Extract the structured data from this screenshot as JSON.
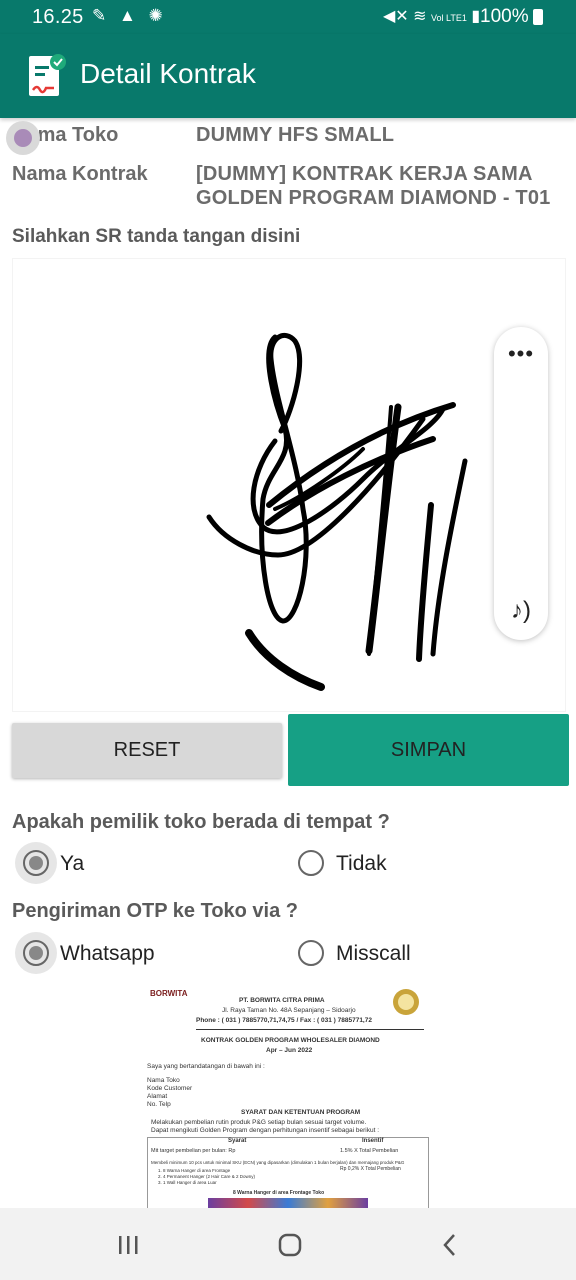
{
  "status_bar": {
    "time": "16.25",
    "left_icons": [
      "tools-icon",
      "warning-icon",
      "aperture-icon"
    ],
    "network": "Vol LTE1",
    "battery": "100%"
  },
  "app_bar": {
    "title": "Detail Kontrak",
    "icon": "contract-document-icon",
    "color": "#08796b"
  },
  "info": {
    "store_label": "Nama Toko",
    "store_value": "DUMMY HFS SMALL",
    "contract_label": "Nama Kontrak",
    "contract_value_line1": "[DUMMY] KONTRAK KERJA SAMA",
    "contract_value_line2": "GOLDEN PROGRAM DIAMOND - T01"
  },
  "signature": {
    "prompt": "Silahkan SR tanda tangan disini",
    "side_panel": {
      "more": "•••",
      "sound_icon": "music-note-sound-icon"
    }
  },
  "buttons": {
    "reset": "RESET",
    "save": "SIMPAN",
    "save_color": "#16a085"
  },
  "owner_question": {
    "label": "Apakah pemilik toko berada di tempat ?",
    "options": [
      {
        "label": "Ya",
        "checked": true
      },
      {
        "label": "Tidak",
        "checked": false
      }
    ]
  },
  "otp_question": {
    "label": "Pengiriman OTP ke Toko via ?",
    "options": [
      {
        "label": "Whatsapp",
        "checked": true
      },
      {
        "label": "Misscall",
        "checked": false
      }
    ]
  },
  "document": {
    "brand": "BORWITA",
    "company": "PT. BORWITA CITRA PRIMA",
    "address": "Jl. Raya Taman No. 48A Sepanjang – Sidoarjo",
    "phone": "Phone : ( 031 ) 7885770,71,74,75 / Fax : ( 031 ) 7885771,72",
    "title": "KONTRAK GOLDEN PROGRAM WHOLESALER DIAMOND",
    "period": "Apr – Jun 2022",
    "intro": "Saya yang bertandatangan di bawah ini :",
    "fields": [
      "Nama Toko",
      "Kode Customer",
      "Alamat",
      "No. Telp"
    ],
    "section": "SYARAT DAN KETENTUAN PROGRAM",
    "bullet1": "Melakukan pembelian rutin produk P&G setiap bulan sesuai target volume.",
    "bullet2": "Dapat mengikuti Golden Program dengan perhitungan insentif sebagai berikut :",
    "table_header": [
      "Syarat",
      "Insentif"
    ],
    "row1": [
      "Mit target pembelian per bulan: Rp",
      "1.5% X Total Pembelian"
    ],
    "row2_a": "Membeli minimum 10 pcs untuk minimal SKU (ECN) yang dipasarkan (dimulakan 1 bulan berjalan) dan memajang produk P&G",
    "row2_b": "1. 8 Warna Hanger di area Frontage",
    "row2_c": "2. 4 Permanent Hanger (2 Hair Care & 2 Downy)",
    "row2_d": "3. 1 Wall Hanger di area Luar",
    "row2_incentive": "Rp 0,2% X Total Pembelian",
    "footer": "8 Warna Hanger di area Frontage Toko"
  }
}
